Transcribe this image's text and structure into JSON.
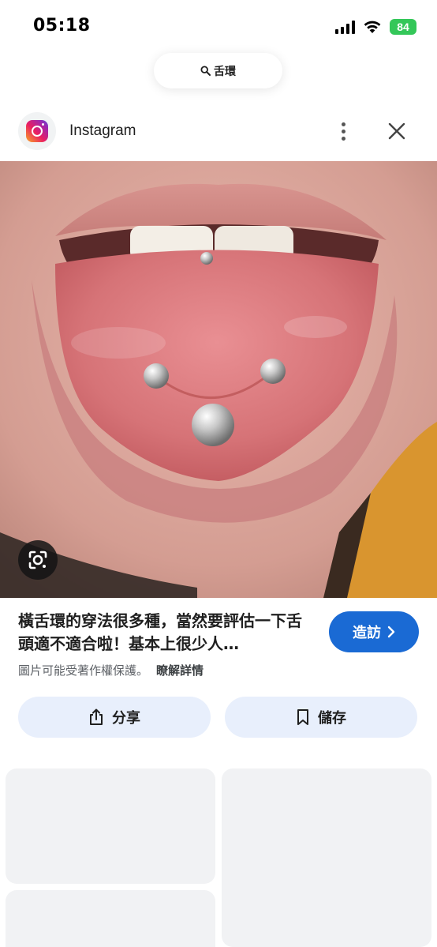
{
  "status_bar": {
    "time": "05:18",
    "battery": "84"
  },
  "search": {
    "query": "舌環"
  },
  "source": {
    "name": "Instagram",
    "logo_icon": "instagram-icon"
  },
  "caption": {
    "text": "橫舌環的穿法很多種，當然要評估一下舌頭適不適合啦！基本上很少人…"
  },
  "visit": {
    "label": "造訪"
  },
  "copyright": {
    "notice": "圖片可能受著作權保護。",
    "learn_more": "瞭解詳情"
  },
  "actions": {
    "share_label": "分享",
    "save_label": "儲存"
  },
  "colors": {
    "accent": "#1a6ad4",
    "action_bg": "#e8effc",
    "battery": "#34c759",
    "card_bg": "#f1f2f4"
  }
}
